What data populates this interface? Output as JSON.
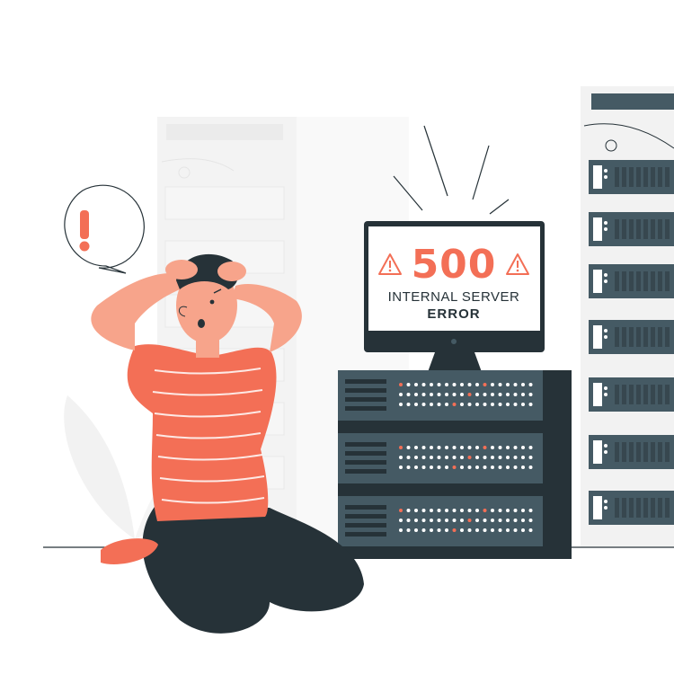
{
  "error": {
    "code": "500",
    "line1": "INTERNAL SERVER",
    "line2": "ERROR"
  },
  "speech_bubble": {
    "symbol": "!"
  },
  "colors": {
    "accent": "#f36f56",
    "dark": "#263238",
    "server_body": "#455a64",
    "light_rack": "#ebebeb",
    "skin": "#f7a48b"
  },
  "icons": [
    "warning-icon",
    "exclamation-icon"
  ]
}
